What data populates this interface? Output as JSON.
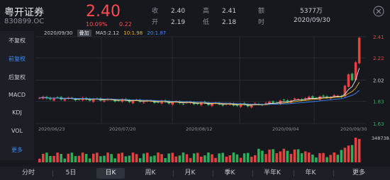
{
  "header": {
    "name": "粤开证券",
    "code": "830899.OC",
    "price": "2.40",
    "change_pct": "10.09%",
    "change": "0.22",
    "quotes": [
      {
        "label": "收",
        "value": "2.40"
      },
      {
        "label": "高",
        "value": "2.41"
      },
      {
        "label": "额",
        "value": "5377万"
      },
      {
        "label": "开",
        "value": "2.19"
      },
      {
        "label": "低",
        "value": "2.18"
      },
      {
        "label": "时",
        "value": "2020/09/30"
      }
    ]
  },
  "sidebar": {
    "items": [
      {
        "label": "不复权"
      },
      {
        "label": "前复权"
      },
      {
        "label": "后复权"
      },
      {
        "label": "MACD"
      },
      {
        "label": "KDJ"
      },
      {
        "label": "VOL"
      },
      {
        "label": "更多"
      }
    ],
    "active_index": 1
  },
  "chart_info": {
    "top_date": "2020/09/30",
    "overlay_tag": "叠加",
    "ma5": "MA5:2.12",
    "ma10": "10:1.98",
    "ma20": "20:1.87",
    "ma_colors": {
      "ma5": "#e8eaee",
      "ma10": "#f0b429",
      "ma20": "#3b8bff"
    }
  },
  "chart_data": {
    "type": "candlestick",
    "y_ticks": [
      "2.41",
      "2.22",
      "2.02",
      "1.83",
      "1.63"
    ],
    "y_range": [
      1.63,
      2.41
    ],
    "x_ticks": [
      "2020/06/23",
      "2020/07/20",
      "2020/08/12",
      "2020/09/04",
      "2020/09/30"
    ],
    "volume_max_label": "348738.00",
    "colors": {
      "up": "#e84040",
      "down": "#2eae5b"
    }
  },
  "tabs": [
    {
      "label": "分时"
    },
    {
      "label": "5日"
    },
    {
      "label": "日K"
    },
    {
      "label": "周K"
    },
    {
      "label": "月K"
    },
    {
      "label": "季K"
    },
    {
      "label": "半年K"
    },
    {
      "label": "年K"
    },
    {
      "label": "更多"
    }
  ],
  "active_tab": 2
}
